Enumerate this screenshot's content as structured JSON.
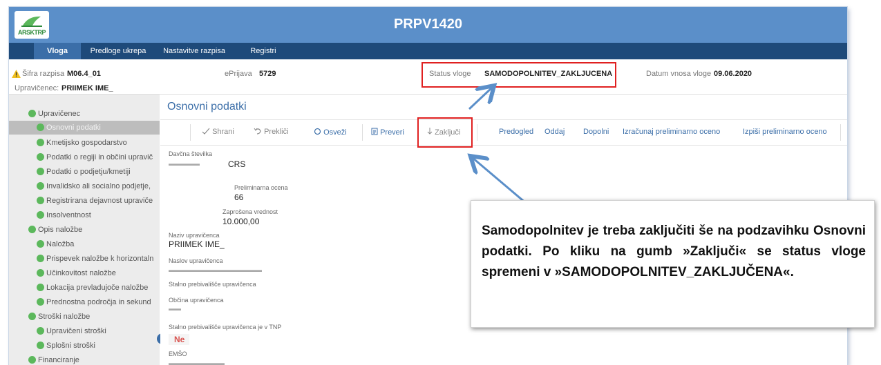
{
  "app": {
    "title": "PRPV1420",
    "logo_text": "ARSKTRP",
    "colors": {
      "titlebar": "#5b8fc9",
      "navbar": "#1e4a7a",
      "accent": "#3b6ea8",
      "status_dot": "#5cb85c",
      "highlight_box": "#e02020"
    }
  },
  "nav": {
    "tabs": [
      "Vloga",
      "Predloge ukrepa",
      "Nastavitve razpisa",
      "Registri"
    ],
    "active": "Vloga"
  },
  "info": {
    "warning_icon": "warning-triangle-icon",
    "sifra_label": "Šifra razpisa",
    "sifra_value": "M06.4_01",
    "eprijava_label": "ePrijava",
    "eprijava_value": "5729",
    "status_label": "Status vloge",
    "status_value": "SAMODOPOLNITEV_ZAKLJUCENA",
    "datum_label": "Datum vnosa vloge",
    "datum_value": "09.06.2020",
    "upravicenec_label": "Upravičenec:",
    "upravicenec_value": "PRIIMEK IME_"
  },
  "sidebar": {
    "items": [
      "Upravičenec",
      "Osnovni podatki",
      "Kmetijsko gospodarstvo",
      "Podatki o regiji in občini upravič",
      "Podatki o podjetju/kmetiji",
      "Invalidsko ali socialno podjetje,",
      "Registrirana dejavnost upraviče",
      "Insolventnost",
      "Opis naložbe",
      "Naložba",
      "Prispevek naložbe k horizontaln",
      "Učinkovitost naložbe",
      "Lokacija prevladujoče naložbe",
      "Prednostna področja in sekund",
      "Stroški naložbe",
      "Upravičeni stroški",
      "Splošni stroški",
      "Financiranje"
    ]
  },
  "content": {
    "section_title": "Osnovni podatki",
    "toolbar": {
      "shrani": "Shrani",
      "preklici": "Prekliči",
      "osvezi": "Osveži",
      "preveri": "Preveri",
      "zakljuci": "Zaključi",
      "predogled": "Predogled",
      "oddaj": "Oddaj",
      "dopolni": "Dopolni",
      "izracunaj": "Izračunaj preliminarno oceno",
      "izpisi": "Izpiši preliminarno oceno"
    },
    "fields": {
      "davcna_label": "Davčna številka",
      "davcna_value": "CRS",
      "ocena_label": "Preliminarna ocena",
      "ocena_value": "66",
      "vrednost_label": "Zaprošena vrednost",
      "vrednost_value": "10.000,00",
      "naziv_label": "Naziv upravičenca",
      "naziv_value": "PRIIMEK IME_",
      "naslov_label": "Naslov upravičenca",
      "stalno_label": "Stalno prebivališče upravičenca",
      "obcina_label": "Občina upravičenca",
      "tnp_label": "Stalno prebivališče upravičenca je v TNP",
      "tnp_value": "Ne",
      "emso_label": "EMŠO"
    }
  },
  "callout": {
    "text": "Samodopolnitev je treba zaključiti še na podzavihku Osnovni podatki. Po kliku na gumb »Zaključi« se status vloge spremeni v »SAMODOPOLNITEV_ZAKLJUČENA«."
  }
}
